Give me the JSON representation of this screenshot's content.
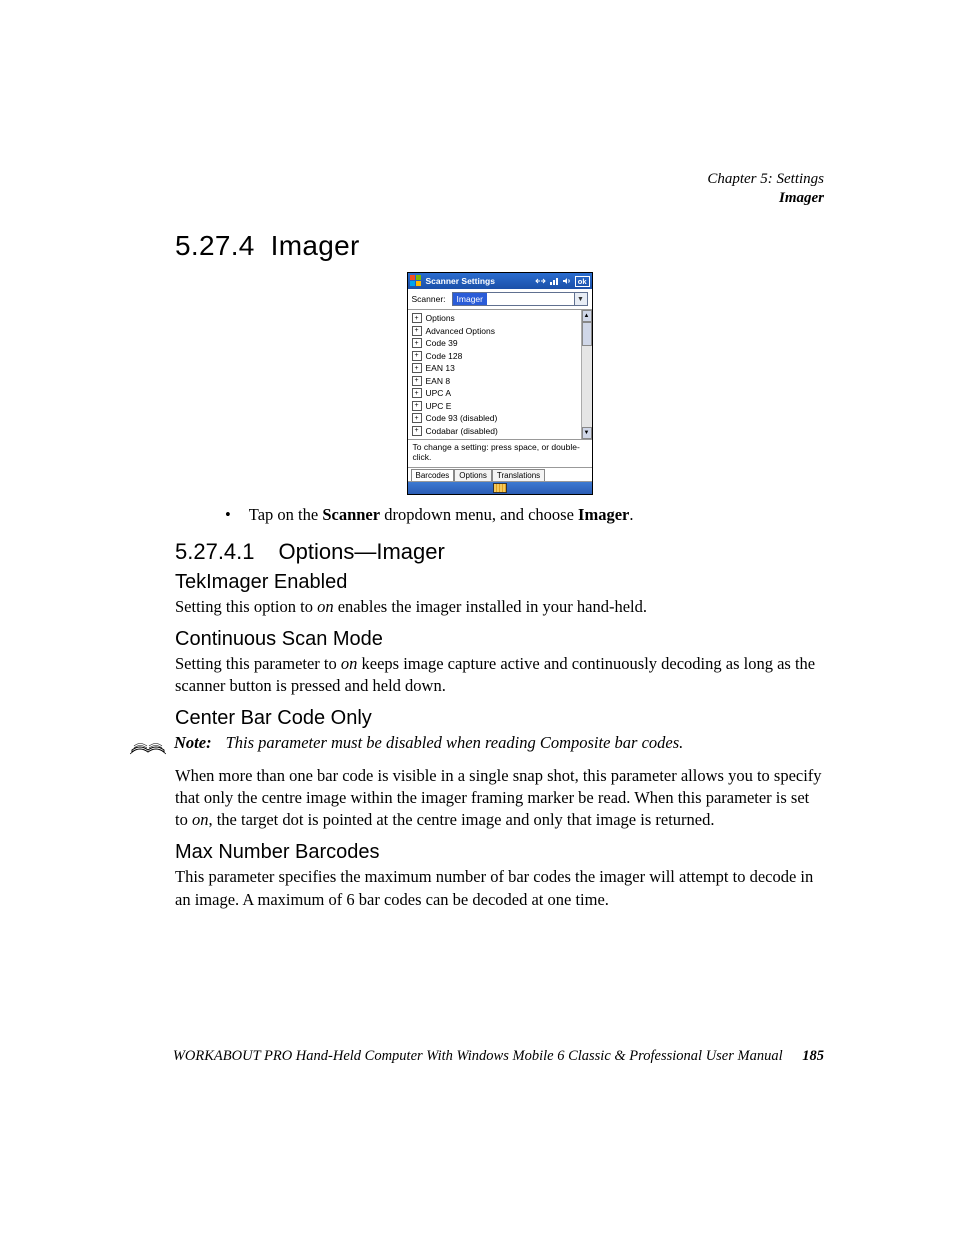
{
  "header": {
    "chapter": "Chapter 5: Settings",
    "section": "Imager"
  },
  "h1": {
    "num": "5.27.4",
    "title": "Imager"
  },
  "screenshot": {
    "title": "Scanner Settings",
    "ok": "ok",
    "scanner_label": "Scanner:",
    "scanner_value": "Imager",
    "items": [
      "Options",
      "Advanced Options",
      "Code 39",
      "Code 128",
      "EAN 13",
      "EAN 8",
      "UPC A",
      "UPC E",
      "Code 93 (disabled)",
      "Codabar (disabled)"
    ],
    "hint": "To change a setting: press space, or double-click.",
    "tabs": [
      "Barcodes",
      "Options",
      "Translations"
    ]
  },
  "bullet1_a": "Tap on the ",
  "bullet1_b": "Scanner",
  "bullet1_c": " dropdown menu, and choose ",
  "bullet1_d": "Imager",
  "bullet1_e": ".",
  "h2": {
    "num": "5.27.4.1",
    "title": "Options—Imager"
  },
  "sec1": {
    "title": "TekImager Enabled",
    "p_a": "Setting this option to ",
    "p_on": "on",
    "p_b": " enables the imager installed in your hand-held."
  },
  "sec2": {
    "title": "Continuous Scan Mode",
    "p_a": "Setting this parameter to ",
    "p_on": "on",
    "p_b": " keeps image capture active and continuously decoding as long as the scanner button is pressed and held down."
  },
  "sec3": {
    "title": "Center Bar Code Only",
    "note_label": "Note:",
    "note_text": "This parameter must be disabled when reading Composite bar codes.",
    "p_a": "When more than one bar code is visible in a single snap shot, this parameter allows you to specify that only the centre image within the imager framing marker be read. When this parameter is set to ",
    "p_on": "on",
    "p_b": ", the target dot is pointed at the centre image and only that image is returned."
  },
  "sec4": {
    "title": "Max Number Barcodes",
    "p": "This parameter specifies the maximum number of bar codes the imager will attempt to decode in an image. A maximum of 6 bar codes can be decoded at one time."
  },
  "footer": {
    "text": "WORKABOUT PRO Hand-Held Computer With Windows Mobile 6 Classic & Professional User Manual",
    "page": "185"
  }
}
